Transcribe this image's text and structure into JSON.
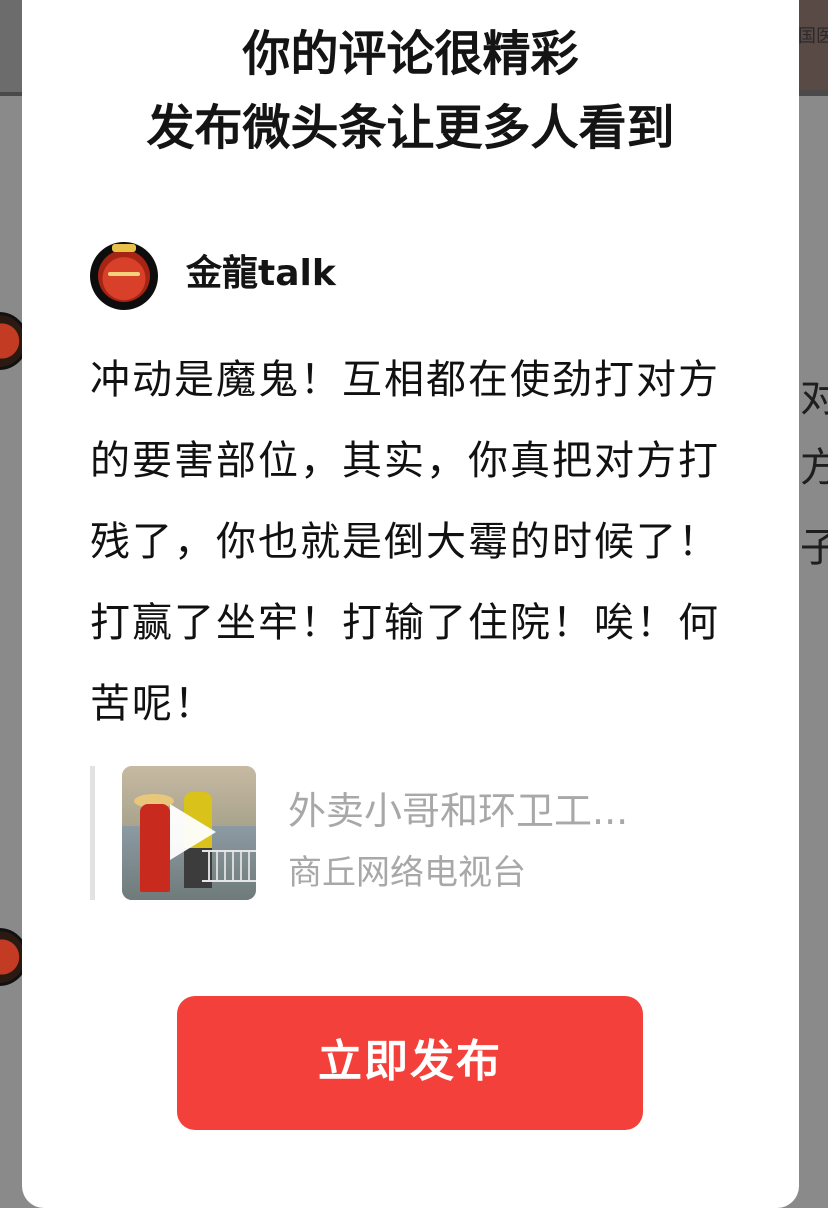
{
  "modal": {
    "title_line1": "你的评论很精彩",
    "title_line2": "发布微头条让更多人看到",
    "author": {
      "name": "金龍talk"
    },
    "comment": "冲动是魔鬼！互相都在使劲打对方的要害部位，其实，你真把对方打残了，你也就是倒大霉的时候了！打赢了坐牢！打输了住院！唉！何苦呢！",
    "quoted_video": {
      "title": "外卖小哥和环卫工...",
      "source": "商丘网络电视台"
    },
    "publish_button_label": "立即发布"
  },
  "background": {
    "top_right_text": "国医",
    "right_edge_fragments": [
      "对",
      "方",
      "子"
    ]
  },
  "colors": {
    "accent": "#f4403a",
    "overlay": "#8a8a8a",
    "muted_text": "#a8a8a8"
  }
}
